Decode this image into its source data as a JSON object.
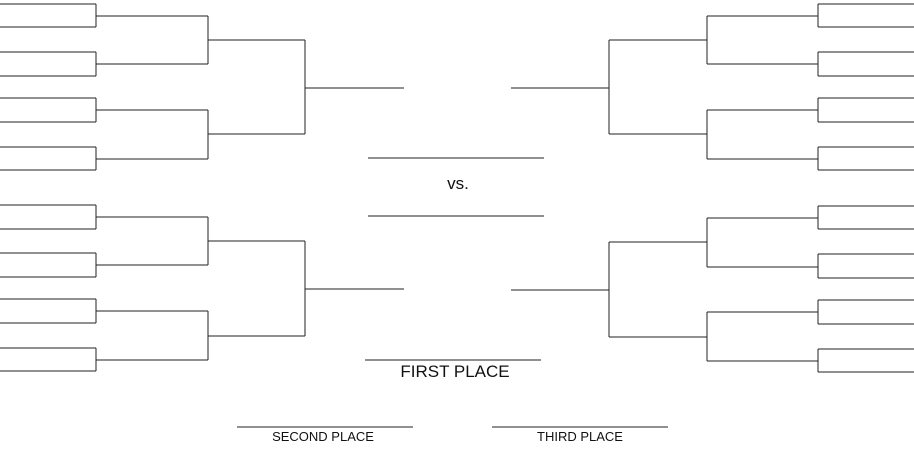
{
  "labels": {
    "vs": "vs.",
    "first_place": "FIRST PLACE",
    "second_place": "SECOND PLACE",
    "third_place": "THIRD PLACE"
  },
  "colors": {
    "line": "#222222",
    "background": "#ffffff"
  }
}
